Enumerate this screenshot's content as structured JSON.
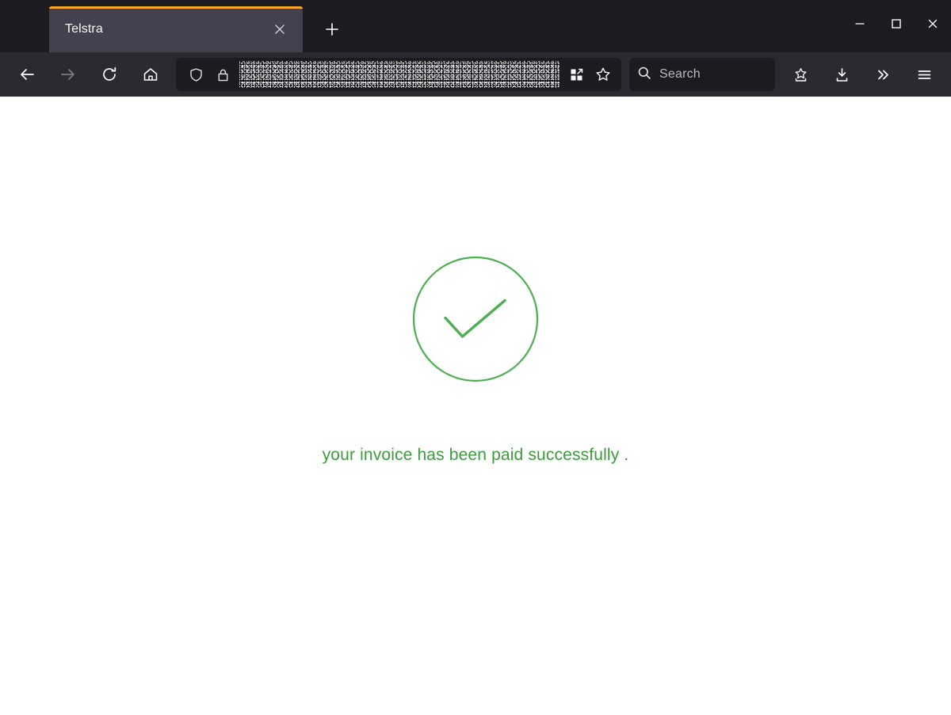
{
  "window": {
    "controls": {
      "minimize_label": "Minimize",
      "maximize_label": "Maximize",
      "close_label": "Close"
    }
  },
  "tabstrip": {
    "tabs": [
      {
        "title": "Telstra",
        "active": true,
        "accent_color": "#ffa724",
        "close_label": "Close tab"
      }
    ],
    "new_tab_label": "New tab"
  },
  "toolbar": {
    "back_label": "Go back one page",
    "forward_label": "Go forward one page",
    "reload_label": "Reload current page",
    "home_label": "Home",
    "shield_label": "Enhanced tracking protection",
    "lock_label": "Connection secure",
    "url_value": "",
    "url_state": "redacted",
    "extensions_label": "Extensions",
    "bookmark_star_label": "Bookmark this page",
    "save_to_pocket_label": "Save to Pocket",
    "downloads_label": "Downloads",
    "overflow_label": "More tools",
    "menu_label": "Open application menu"
  },
  "search": {
    "placeholder": "Search",
    "value": "",
    "icon": "search-icon"
  },
  "page": {
    "background_color": "#ffffff",
    "status_icon": "circle-check-icon",
    "status_color": "#4caf50",
    "message": "your invoice has been paid successfully .",
    "message_color": "#3d9b3d"
  }
}
